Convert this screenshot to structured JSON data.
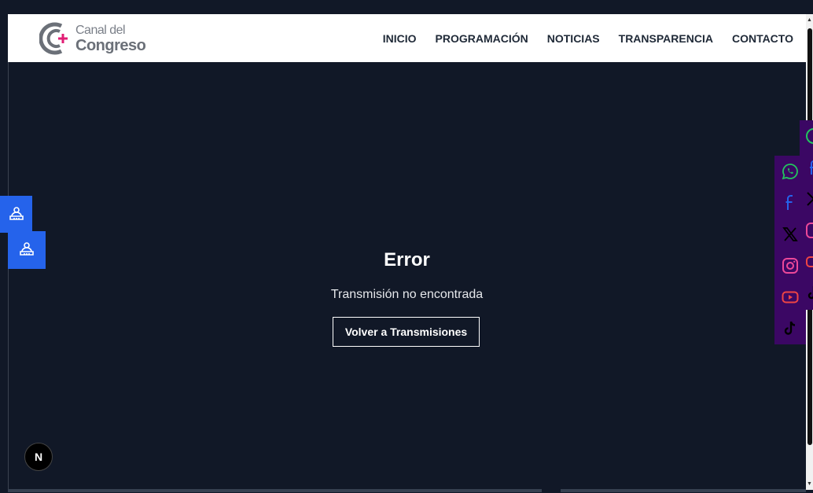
{
  "brand": {
    "line1": "Canal del",
    "line2": "Congreso",
    "accent_color": "#e11d74"
  },
  "nav": [
    {
      "label": "INICIO"
    },
    {
      "label": "PROGRAMACIÓN"
    },
    {
      "label": "NOTICIAS"
    },
    {
      "label": "TRANSPARENCIA"
    },
    {
      "label": "CONTACTO"
    }
  ],
  "error": {
    "title": "Error",
    "message": "Transmisión no encontrada",
    "button_label": "Volver a Transmisiones"
  },
  "accessibility": {
    "icon": "accessibility-icon",
    "color": "#2563eb"
  },
  "social": {
    "background": "#3b0764",
    "items": [
      {
        "icon": "whatsapp-icon",
        "color": "#22c55e"
      },
      {
        "icon": "facebook-icon",
        "color": "#2563eb"
      },
      {
        "icon": "x-icon",
        "color": "#000000"
      },
      {
        "icon": "instagram-icon",
        "color": "#ec4899"
      },
      {
        "icon": "youtube-icon",
        "color": "#ef4444"
      },
      {
        "icon": "tiktok-icon",
        "color": "#000000"
      }
    ]
  },
  "dev_badge": {
    "label": "N"
  }
}
